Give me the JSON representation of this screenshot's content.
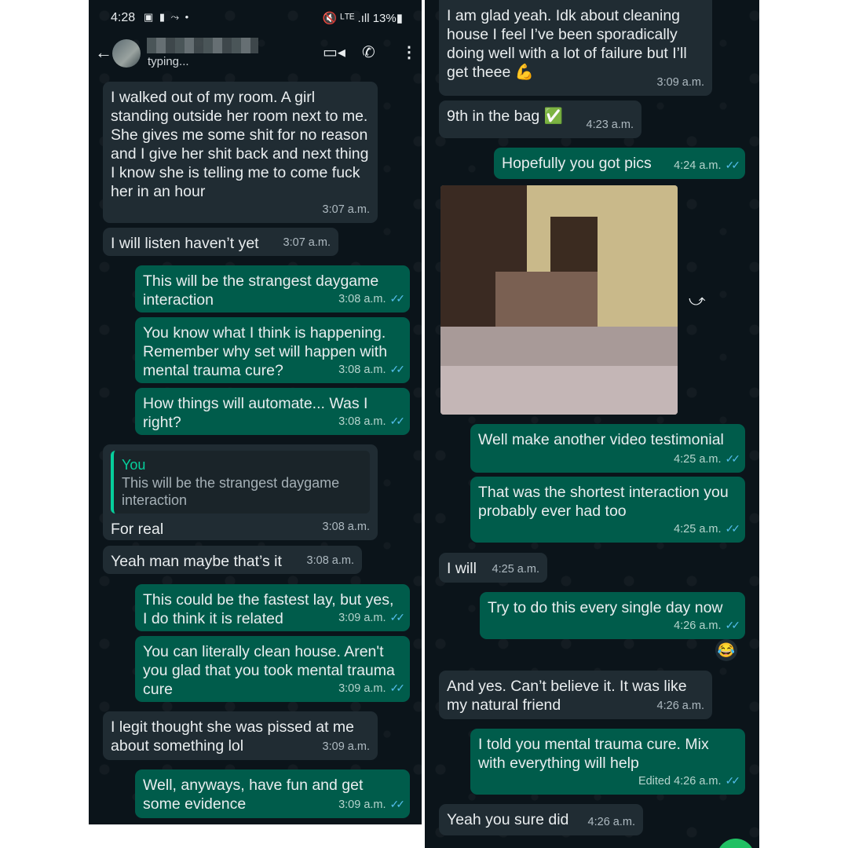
{
  "status": {
    "time": "4:28",
    "icons": "▣ ▮ ⤳ •",
    "right": "🔇 ᴸᵀᴱ .ıll 13%▮"
  },
  "header": {
    "typing": "typing...",
    "back": "←",
    "video": "▭◂",
    "call": "✆",
    "more": "⋮"
  },
  "left_messages": [
    {
      "type": "in",
      "text": "I walked out of my room. A girl standing outside her room next to me. She gives me some shit for no reason and I give her shit back and next thing I know she is telling me to come fuck her in an hour",
      "time": "3:07 a.m."
    },
    {
      "type": "in",
      "text": "I will listen haven’t yet",
      "time": "3:07 a.m."
    },
    {
      "type": "out",
      "text": "This will be the strangest daygame interaction",
      "time": "3:08 a.m."
    },
    {
      "type": "out",
      "text": "You know what I think is happening. Remember why set will happen with mental trauma cure?",
      "time": "3:08 a.m."
    },
    {
      "type": "out",
      "text": "How things will automate... Was I right?",
      "time": "3:08 a.m."
    },
    {
      "type": "in",
      "quote_name": "You",
      "quote_text": "This will be the strangest daygame interaction",
      "text": "For real",
      "time": "3:08 a.m."
    },
    {
      "type": "in",
      "text": "Yeah man maybe that’s it",
      "time": "3:08 a.m."
    },
    {
      "type": "out",
      "text": "This could be the fastest lay, but yes, I do think it is related",
      "time": "3:09 a.m."
    },
    {
      "type": "out",
      "text": "You can literally clean house. Aren't you glad that you took mental trauma cure",
      "time": "3:09 a.m."
    },
    {
      "type": "in",
      "text": "I legit thought she was pissed at me about something lol",
      "time": "3:09 a.m."
    },
    {
      "type": "out",
      "text": "Well, anyways, have fun and get some evidence",
      "time": "3:09 a.m."
    }
  ],
  "right_messages": [
    {
      "type": "in",
      "text": "I am glad yeah. Idk about cleaning house I feel I’ve been sporadically doing well with a lot of failure but I’ll get theee 💪",
      "time": "3:09 a.m."
    },
    {
      "type": "in",
      "text": "9th in the bag ✅",
      "time": "4:23 a.m."
    },
    {
      "type": "out",
      "text": "Hopefully you got pics",
      "time": "4:24 a.m."
    },
    {
      "type": "out",
      "text": "Well make another video testimonial",
      "time": "4:25 a.m."
    },
    {
      "type": "out",
      "text": "That was the shortest interaction you probably ever had too",
      "time": "4:25 a.m."
    },
    {
      "type": "in",
      "text": "I will",
      "time": "4:25 a.m."
    },
    {
      "type": "out",
      "text": "Try to do this every single day now",
      "time": "4:26 a.m."
    },
    {
      "type": "in",
      "text": "And yes. Can’t believe it. It was like my natural friend",
      "time": "4:26 a.m."
    },
    {
      "type": "out",
      "text": "I told you mental trauma cure. Mix with everything will help",
      "time": "Edited 4:26 a.m."
    },
    {
      "type": "in",
      "text": "Yeah you sure did",
      "time": "4:26 a.m."
    }
  ],
  "reaction": "😂",
  "forward_icon": "⤻",
  "colors": {
    "incoming": "#202c33",
    "outgoing": "#005c4b",
    "background": "#0b141a",
    "ticks": "#53bdeb",
    "quote_accent": "#06cf9c"
  }
}
